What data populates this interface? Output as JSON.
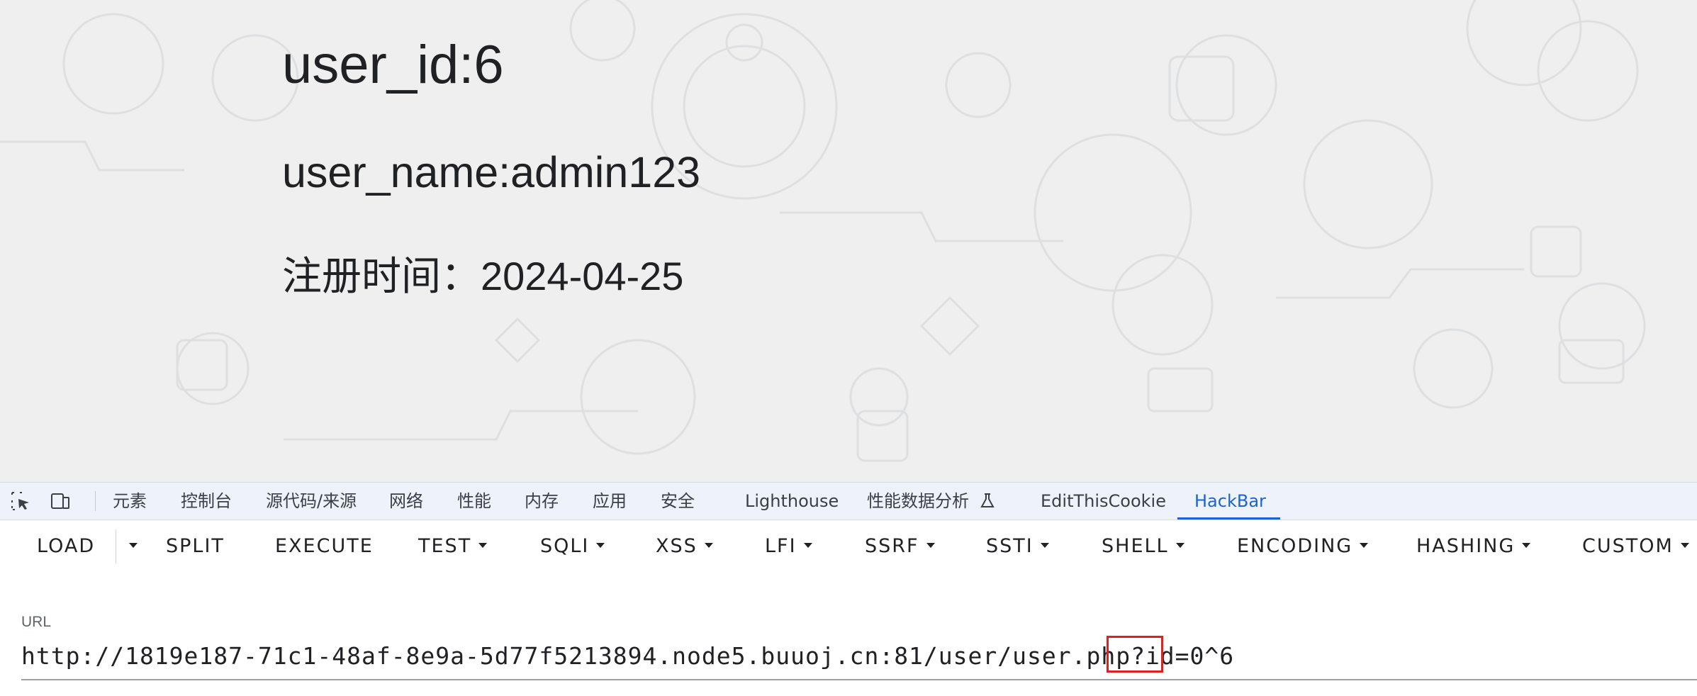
{
  "page": {
    "user_id": "user_id:6",
    "user_name": "user_name:admin123",
    "register_time": "注册时间：2024-04-25"
  },
  "devtools": {
    "tabs": [
      {
        "label": "元素"
      },
      {
        "label": "控制台"
      },
      {
        "label": "源代码/来源"
      },
      {
        "label": "网络"
      },
      {
        "label": "性能"
      },
      {
        "label": "内存"
      },
      {
        "label": "应用"
      },
      {
        "label": "安全"
      },
      {
        "label": "Lighthouse"
      },
      {
        "label": "性能数据分析"
      },
      {
        "label": "EditThisCookie"
      },
      {
        "label": "HackBar"
      }
    ],
    "active_tab": "HackBar",
    "icons": [
      "inspect-element-icon",
      "device-toolbar-icon",
      "flask-icon"
    ]
  },
  "hackbar": {
    "buttons": [
      {
        "label": "LOAD"
      },
      {
        "label": "SPLIT"
      },
      {
        "label": "EXECUTE"
      },
      {
        "label": "TEST"
      },
      {
        "label": "SQLI"
      },
      {
        "label": "XSS"
      },
      {
        "label": "LFI"
      },
      {
        "label": "SSRF"
      },
      {
        "label": "SSTI"
      },
      {
        "label": "SHELL"
      },
      {
        "label": "ENCODING"
      },
      {
        "label": "HASHING"
      },
      {
        "label": "CUSTOM"
      }
    ],
    "url_label": "URL",
    "url_value": "http://1819e187-71c1-48af-8e9a-5d77f5213894.node5.buuoj.cn:81/user/user.php?id=0^6"
  },
  "colors": {
    "accent": "#1a62d8",
    "highlight": "#e02020"
  }
}
